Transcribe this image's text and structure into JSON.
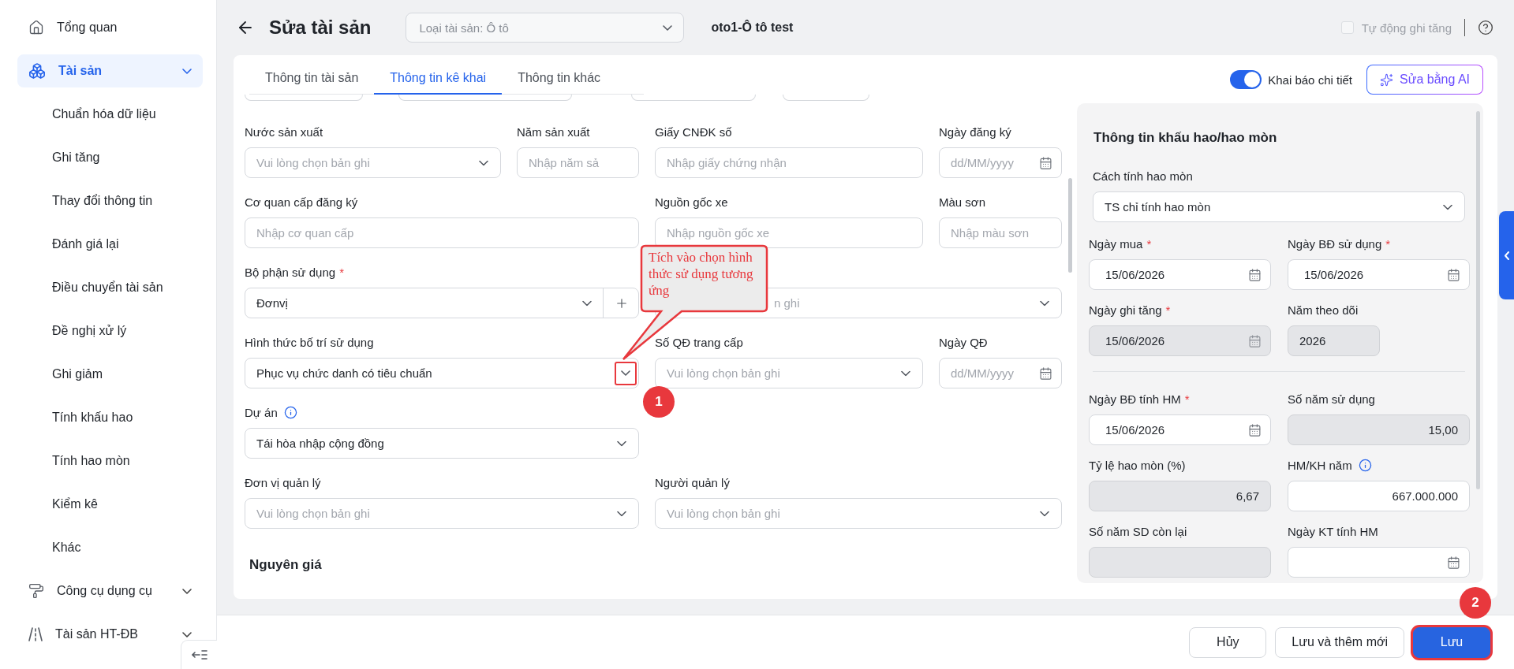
{
  "sidebar": {
    "items": [
      {
        "label": "Tổng quan",
        "selected": false
      },
      {
        "label": "Tài sản",
        "selected": true,
        "expanded": true,
        "children": [
          {
            "label": "Chuẩn hóa dữ liệu",
            "selected": false
          },
          {
            "label": "Ghi tăng",
            "selected": false
          },
          {
            "label": "Thay đổi thông tin",
            "selected": false
          },
          {
            "label": "Đánh giá lại",
            "selected": false
          },
          {
            "label": "Điều chuyển tài sản",
            "selected": false
          },
          {
            "label": "Đề nghị xử lý",
            "selected": false
          },
          {
            "label": "Ghi giảm",
            "selected": false
          },
          {
            "label": "Tính khấu hao",
            "selected": false
          },
          {
            "label": "Tính hao mòn",
            "selected": false
          },
          {
            "label": "Kiểm kê",
            "selected": false
          },
          {
            "label": "Khác",
            "selected": false
          }
        ]
      },
      {
        "label": "Công cụ dụng cụ",
        "selected": false
      },
      {
        "label": "Tài sản HT-ĐB",
        "selected": false
      }
    ]
  },
  "header": {
    "title": "Sửa tài sản",
    "asset_type": "Loại tài sản: Ô tô",
    "asset_name": "oto1-Ô tô test",
    "auto_increase": {
      "label": "Tự động ghi tăng",
      "checked": false,
      "disabled": true
    }
  },
  "tabs": [
    {
      "label": "Thông tin tài sản",
      "selected": false
    },
    {
      "label": "Thông tin kê khai",
      "selected": true
    },
    {
      "label": "Thông tin khác",
      "selected": false
    }
  ],
  "detail_toggle": {
    "label": "Khai báo chi tiết",
    "on": true
  },
  "ai_button": "Sửa bằng AI",
  "form": {
    "fields": [
      {
        "kind": "select",
        "label": "Nước sản xuất",
        "placeholder": "Vui lòng chọn bản ghi"
      },
      {
        "kind": "input",
        "label": "Năm sản xuất",
        "placeholder": "Nhập năm sả"
      },
      {
        "kind": "input",
        "label": "Giấy CNĐK số",
        "placeholder": "Nhập giấy chứng nhận"
      },
      {
        "kind": "date",
        "label": "Ngày đăng ký",
        "placeholder": "dd/MM/yyyy"
      },
      {
        "kind": "input",
        "label": "Cơ quan cấp đăng ký",
        "placeholder": "Nhập cơ quan cấp"
      },
      {
        "kind": "input",
        "label": "Nguồn gốc xe",
        "placeholder": "Nhập nguồn gốc xe"
      },
      {
        "kind": "input",
        "label": "Màu sơn",
        "placeholder": "Nhập màu sơn"
      },
      {
        "kind": "select-add",
        "label": "Bộ phận sử dụng",
        "required_mark": "*",
        "value": "Đơnvị"
      },
      {
        "kind": "select",
        "placeholder": "n ghi"
      },
      {
        "kind": "select",
        "label": "Hình thức bố trí sử dụng",
        "value": "Phục vụ chức danh có tiêu chuẩn",
        "highlighted": true
      },
      {
        "kind": "select",
        "label": "Số QĐ trang cấp",
        "placeholder": "Vui lòng chọn bản ghi"
      },
      {
        "kind": "date",
        "label": "Ngày QĐ",
        "placeholder": "dd/MM/yyyy"
      },
      {
        "kind": "select",
        "label": "Dự án",
        "info": true,
        "value": "Tái hòa nhập cộng đồng"
      },
      {
        "kind": "select",
        "label": "Đơn vị quản lý",
        "placeholder": "Vui lòng chọn bản ghi"
      },
      {
        "kind": "select",
        "label": "Người quản lý",
        "placeholder": "Vui lòng chọn bản ghi"
      }
    ],
    "section_heading": "Nguyên giá"
  },
  "callout": {
    "text": "Tích vào chọn hình thức sử dụng tương ứng",
    "step": "1"
  },
  "depreciation": {
    "title": "Thông tin khấu hao/hao mòn",
    "method": {
      "label": "Cách tính hao mòn",
      "value": "TS chỉ tính hao mòn"
    },
    "groups": [
      [
        {
          "kind": "date",
          "label": "Ngày mua",
          "required_mark": "*",
          "value": "15/06/2026",
          "readonly": false
        },
        {
          "kind": "date",
          "label": "Ngày BĐ sử dụng",
          "required_mark": "*",
          "value": "15/06/2026",
          "readonly": false
        },
        {
          "kind": "date",
          "label": "Ngày ghi tăng",
          "required_mark": "*",
          "value": "15/06/2026",
          "readonly": true
        },
        {
          "kind": "short",
          "label": "Năm theo dõi",
          "value": "2026",
          "readonly": true
        }
      ],
      [
        {
          "kind": "date",
          "label": "Ngày BĐ tính HM",
          "required_mark": "*",
          "value": "15/06/2026",
          "readonly": false
        },
        {
          "kind": "number",
          "label": "Số năm sử dụng",
          "value": "15,00",
          "readonly": true
        },
        {
          "kind": "number",
          "label": "Tỷ lệ hao mòn (%)",
          "value": "6,67",
          "readonly": true
        },
        {
          "kind": "number",
          "label": "HM/KH năm",
          "info": true,
          "value": "667.000.000",
          "readonly": false
        },
        {
          "kind": "number",
          "label": "Số năm SD còn lại",
          "readonly": true
        },
        {
          "kind": "date",
          "label": "Ngày KT tính HM",
          "readonly": false
        }
      ]
    ]
  },
  "footer": {
    "buttons": [
      {
        "label": "Hủy",
        "kind": "secondary",
        "highlighted": false
      },
      {
        "label": "Lưu và thêm mới",
        "kind": "secondary",
        "highlighted": false
      },
      {
        "label": "Lưu",
        "kind": "primary",
        "highlighted": true,
        "step": "2"
      }
    ]
  }
}
